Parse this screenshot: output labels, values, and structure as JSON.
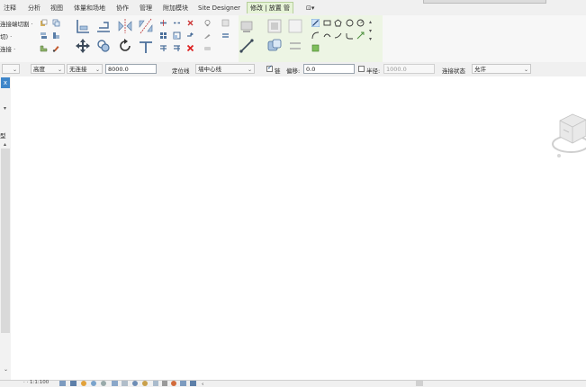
{
  "ribbon_tabs": {
    "annotate": "注释",
    "analyze": "分析",
    "view": "视图",
    "massing": "体量和场地",
    "collaborate": "协作",
    "manage": "管理",
    "addins": "附加模块",
    "site_designer": "Site Designer",
    "modify_active": "修改 | 放置 管",
    "extra": "⊡▾"
  },
  "ribbon_left_labels": {
    "connect": "连接端切割 ·",
    "cut": "切) ·",
    "join": "连接 ·"
  },
  "options_bar": {
    "level_select": "高度",
    "level_dropdown": "无连接",
    "height_value": "8000.0",
    "justification_label": "定位线",
    "justification_select": "墙中心线",
    "chain_label": "链",
    "offset_label": "偏移:",
    "offset_value": "0.0",
    "radius_label": "半径:",
    "radius_value": "1000.0",
    "join_status_label": "连接状态",
    "join_status_select": "允许"
  },
  "left_panel": {
    "close": "x",
    "arrow_down": "▾",
    "label_type": "型",
    "arrow_up": "▴"
  },
  "status_bar": {
    "scale": "· · 1:1:100"
  },
  "colors": {
    "active_tab_bg": "#e6f3d7",
    "selection_blue": "#3f86c9",
    "ribbon_bg": "#f7f7f7"
  }
}
